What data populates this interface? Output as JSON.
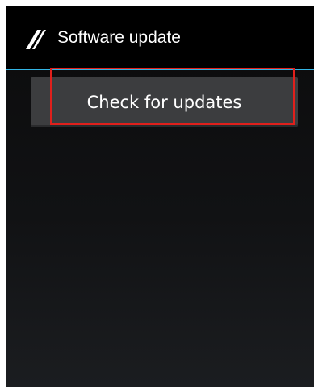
{
  "action_bar": {
    "title": "Software update",
    "icon": "pencil-stripe-icon",
    "divider_color": "#33b5e5"
  },
  "main": {
    "check_button_label": "Check for updates"
  },
  "highlight": {
    "color": "#e0201c"
  }
}
